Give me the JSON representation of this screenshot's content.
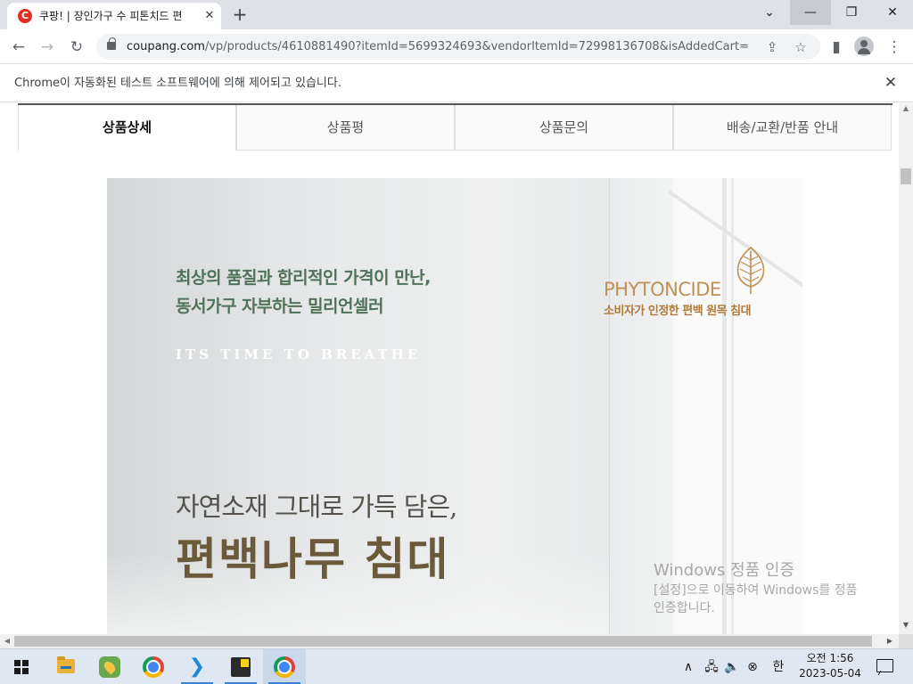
{
  "browser": {
    "tab": {
      "favicon": "coupang-favicon",
      "title": "쿠팡! | 장인가구 수 피톤치드 편",
      "close": "✕"
    },
    "new_tab": "+",
    "window_controls": {
      "tab_search": "⌄",
      "minimize": "—",
      "restore": "❐",
      "close": "✕"
    },
    "nav": {
      "back": "←",
      "forward": "→",
      "reload": "↻"
    },
    "url_host": "coupang.com",
    "url_path": "/vp/products/4610881490?itemId=5699324693&vendorItemId=72998136708&isAddedCart=",
    "icons": {
      "share": "⇪",
      "bookmark": "☆",
      "side_panel": "▮",
      "menu": "⋮"
    }
  },
  "infobar": {
    "message": "Chrome이 자동화된 테스트 소프트웨어에 의해 제어되고 있습니다.",
    "close": "✕"
  },
  "page": {
    "tabs": [
      {
        "label": "상품상세",
        "active": true
      },
      {
        "label": "상품평",
        "active": false
      },
      {
        "label": "상품문의",
        "active": false
      },
      {
        "label": "배송/교환/반품 안내",
        "active": false
      }
    ],
    "banner": {
      "headline_line1": "최상의 품질과 합리적인 가격이 만난,",
      "headline_line2": "동서가구 자부하는 밀리언셀러",
      "tagline": "ITS TIME TO BREATHE",
      "brand": "PHYTONCIDE",
      "brand_sub": "소비자가 인정한 편백 원목 침대",
      "subheading": "자연소재 그대로 가득 담은,",
      "main_heading": "편백나무 침대"
    }
  },
  "watermark": {
    "title": "Windows 정품 인증",
    "line1": "[설정]으로 이동하여 Windows를 정품",
    "line2": "인증합니다."
  },
  "scrollbars": {
    "vertical_position": 0.03,
    "horizontal_position": 0.0
  },
  "taskbar": {
    "apps": [
      "start",
      "file-explorer",
      "maps",
      "chrome",
      "vscode",
      "sticky-notes",
      "chrome-active"
    ],
    "tray": {
      "chevron": "∧",
      "network": "🖧",
      "volume": "🔈",
      "status": "⊗",
      "ime": "한"
    },
    "time": "오전 1:56",
    "date": "2023-05-04"
  },
  "colors": {
    "headline_green": "#4f7359",
    "brand_gold": "#c09152",
    "heading_brown": "#6a5a3a",
    "coupang_red": "#e02f22"
  }
}
